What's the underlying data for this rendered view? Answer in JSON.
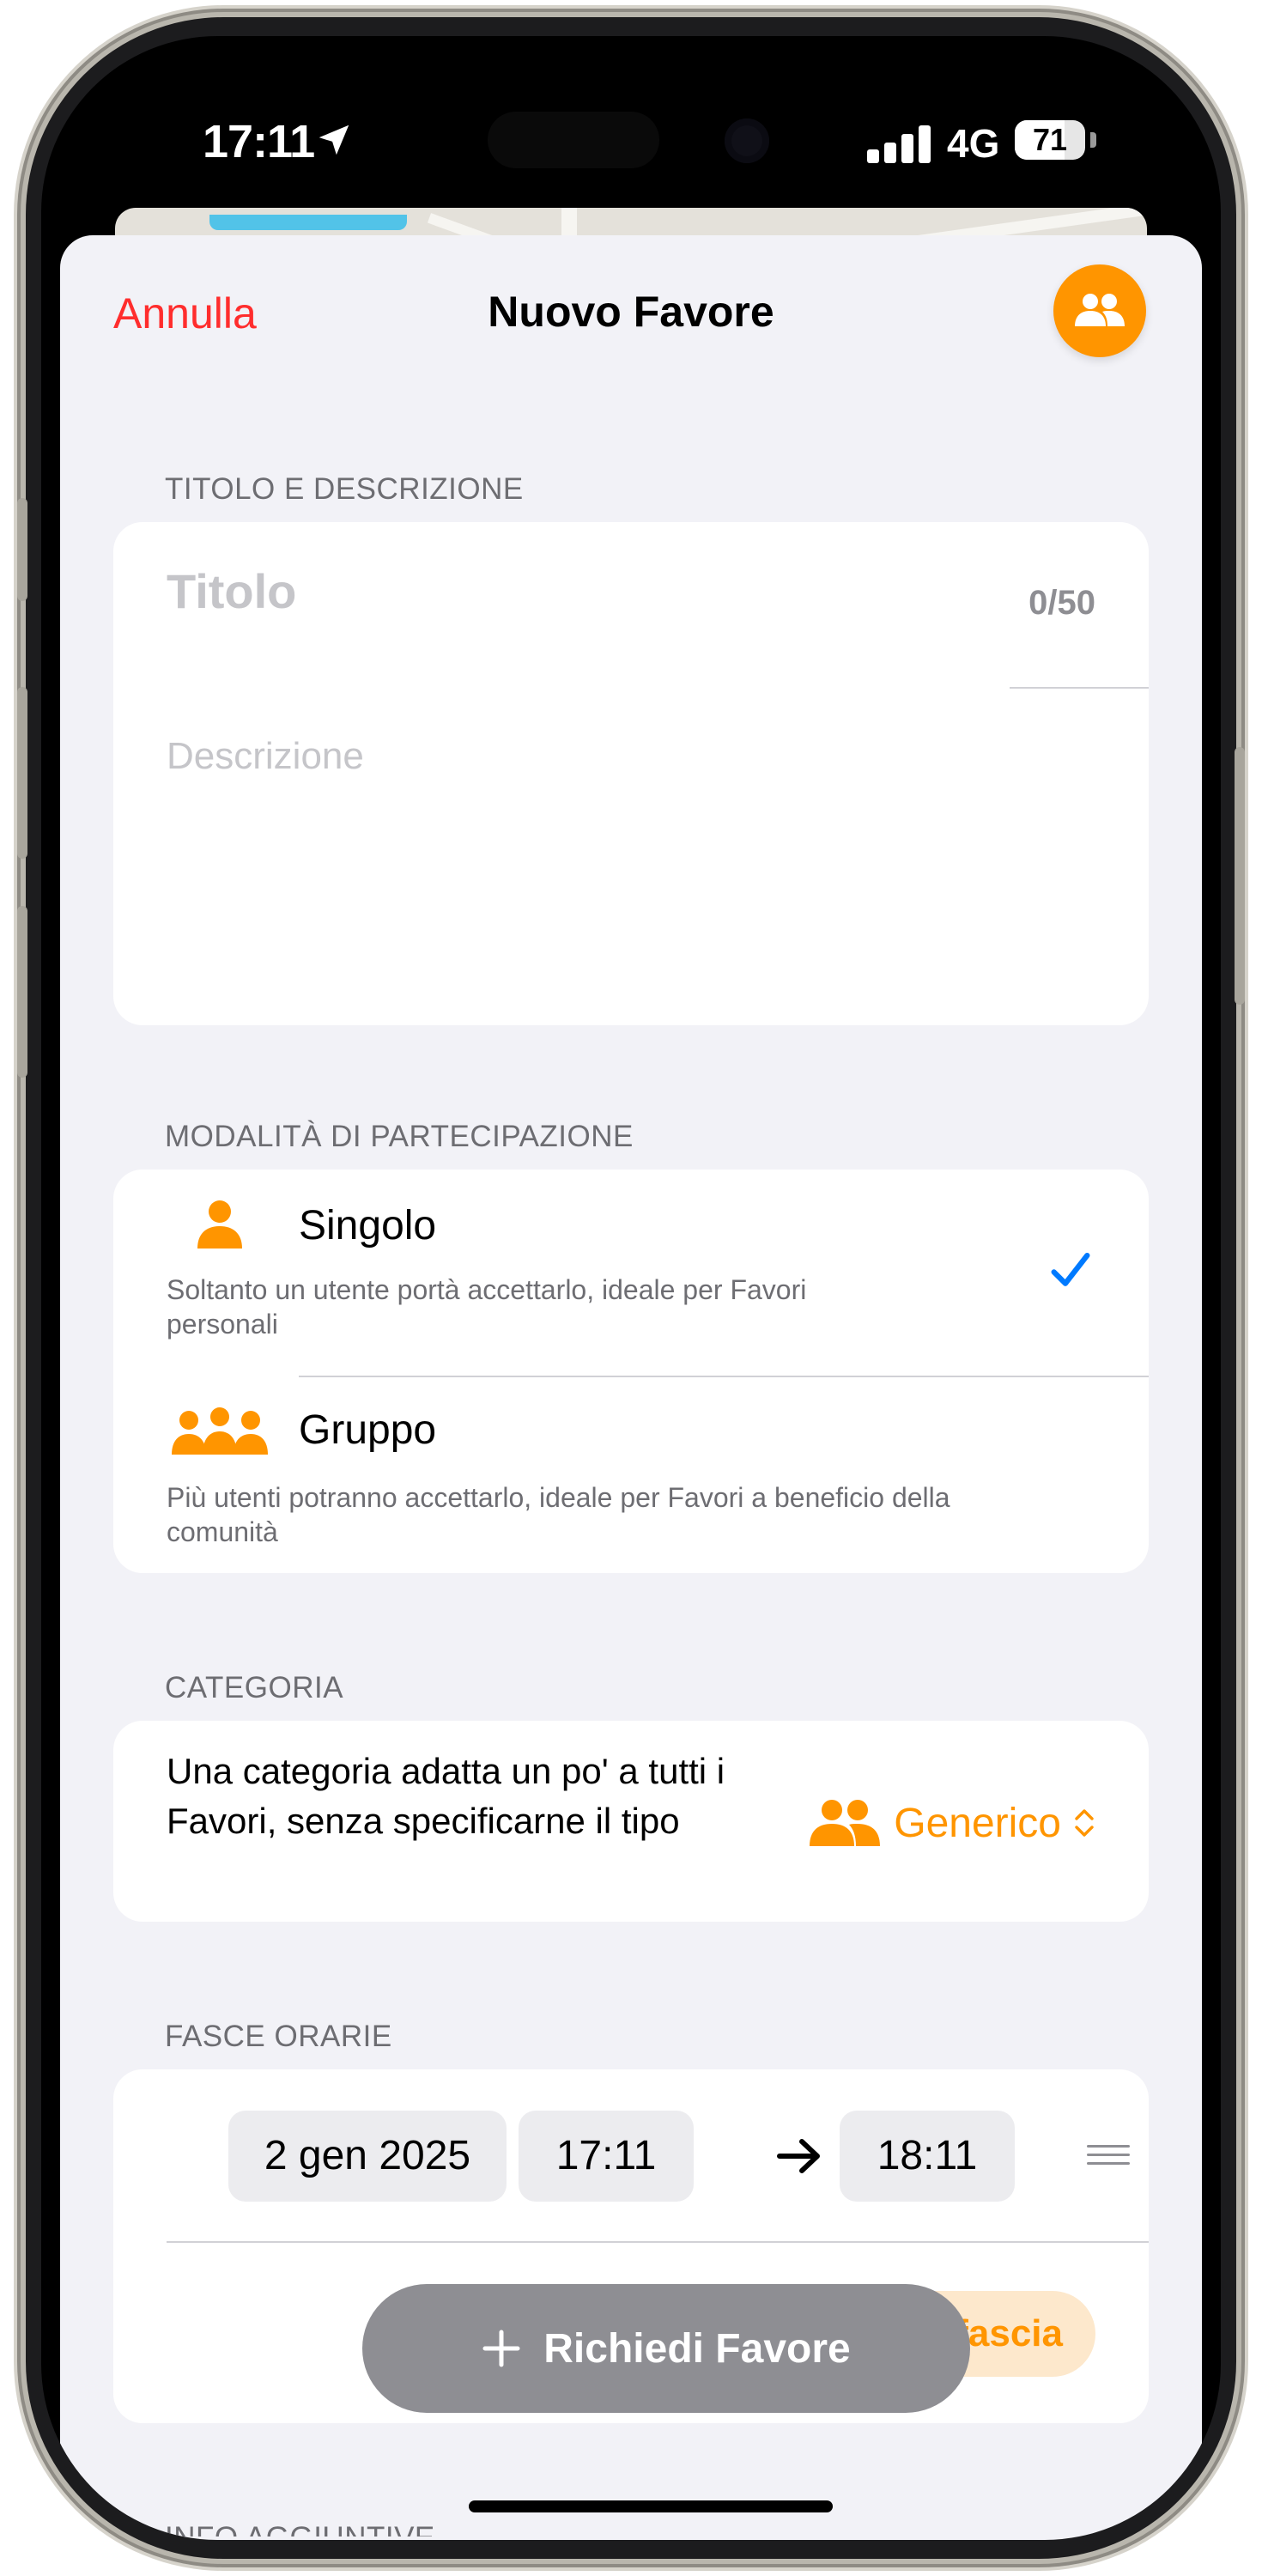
{
  "status_bar": {
    "time": "17:11",
    "network": "4G",
    "battery": "71",
    "battery_level": 0.71
  },
  "nav": {
    "cancel_label": "Annulla",
    "title": "Nuovo Favore",
    "group_button_icon": "person-2-fill-icon"
  },
  "title_section": {
    "header": "TITOLO E DESCRIZIONE",
    "title_placeholder": "Titolo",
    "title_value": "",
    "counter": "0/50",
    "description_placeholder": "Descrizione",
    "description_value": ""
  },
  "mode_section": {
    "header": "MODALITÀ DI PARTECIPAZIONE",
    "options": [
      {
        "name": "Singolo",
        "description": "Soltanto un utente portà accettarlo, ideale per Favori personali",
        "icon": "person-fill-icon",
        "selected": true
      },
      {
        "name": "Gruppo",
        "description": "Più utenti potranno accettarlo, ideale per Favori a beneficio della comunità",
        "icon": "person-3-fill-icon",
        "selected": false
      }
    ]
  },
  "category_section": {
    "header": "CATEGORIA",
    "description": "Una categoria adatta un po' a tutti i Favori, senza specificarne il tipo",
    "selected_value": "Generico",
    "icon": "person-2-fill-icon"
  },
  "time_slots_section": {
    "header": "FASCE ORARIE",
    "slots": [
      {
        "date": "2 gen 2025",
        "start": "17:11",
        "end": "18:11"
      }
    ],
    "add_slot_label": "fascia"
  },
  "next_section": {
    "header": "INFO AGGIUNTIVE"
  },
  "primary_action": {
    "label": "Richiedi Favore"
  },
  "colors": {
    "accent": "#ff9500",
    "destructive": "#ff2d2d",
    "check": "#007aff",
    "background": "#f2f2f7",
    "button_disabled": "#8e8e93"
  }
}
